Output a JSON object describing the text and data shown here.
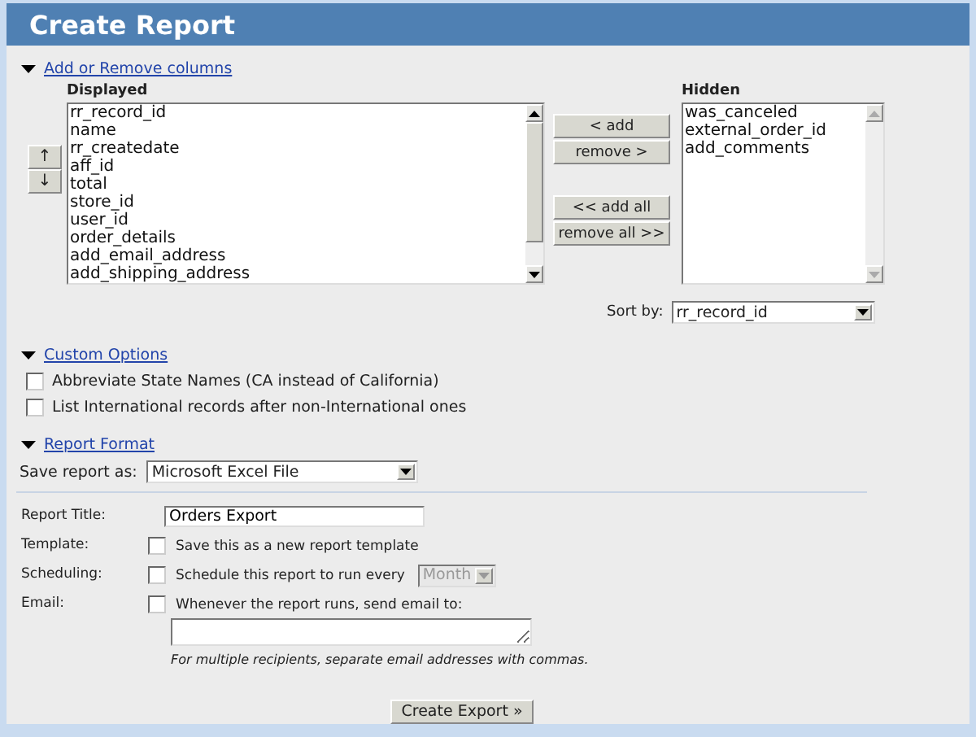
{
  "header": {
    "title": "Create Report"
  },
  "columns_section": {
    "label": "Add or Remove columns",
    "expanded": true,
    "displayed": {
      "label": "Displayed",
      "items": [
        "rr_record_id",
        "name",
        "rr_createdate",
        "aff_id",
        "total",
        "store_id",
        "user_id",
        "order_details",
        "add_email_address",
        "add_shipping_address"
      ]
    },
    "hidden": {
      "label": "Hidden",
      "items": [
        "was_canceled",
        "external_order_id",
        "add_comments"
      ]
    },
    "move_buttons": [
      "↑",
      "↓"
    ],
    "transfer_buttons": [
      "< add",
      "remove >",
      "<< add all",
      "remove all >>"
    ],
    "sort_by": {
      "label": "Sort by:",
      "value": "rr_record_id"
    }
  },
  "custom_options": {
    "label": "Custom Options",
    "expanded": true,
    "options": [
      {
        "label": "Abbreviate State Names (CA instead of California)",
        "checked": false
      },
      {
        "label": "List International records after non-International ones",
        "checked": false
      }
    ]
  },
  "report_format": {
    "label": "Report Format",
    "expanded": true,
    "save_as": {
      "label": "Save report as:",
      "value": "Microsoft Excel File"
    },
    "fields": [
      {
        "kind": "text",
        "label": "Report Title:",
        "value": "Orders Export"
      },
      {
        "kind": "checkbox",
        "label": "Template:",
        "text": "Save this as a new report template",
        "checked": false
      },
      {
        "kind": "schedule",
        "label": "Scheduling:",
        "text": "Schedule this report to run every",
        "checked": false,
        "select": {
          "value": "Month",
          "disabled": true
        }
      },
      {
        "kind": "email",
        "label": "Email:",
        "text": "Whenever the report runs, send email to:",
        "checked": false,
        "hint": "For multiple recipients, separate email addresses with commas."
      }
    ]
  },
  "submit": "Create Export »"
}
